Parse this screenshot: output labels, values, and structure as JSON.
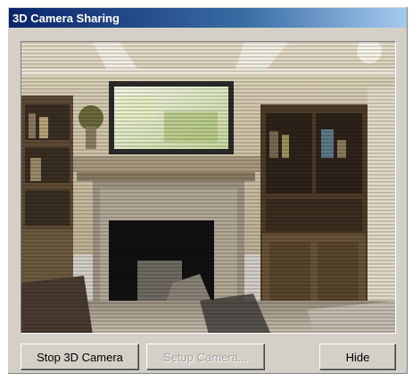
{
  "window": {
    "title": "3D Camera Sharing"
  },
  "video": {
    "description_icon": "camera-feed-image"
  },
  "buttons": {
    "stop_label": "Stop 3D Camera",
    "setup_label": "Setup Camera...",
    "hide_label": "Hide"
  },
  "colors": {
    "title_bar_start": "#0a246a",
    "title_bar_end": "#a6caf0",
    "dialog_face": "#d4d0c8"
  }
}
